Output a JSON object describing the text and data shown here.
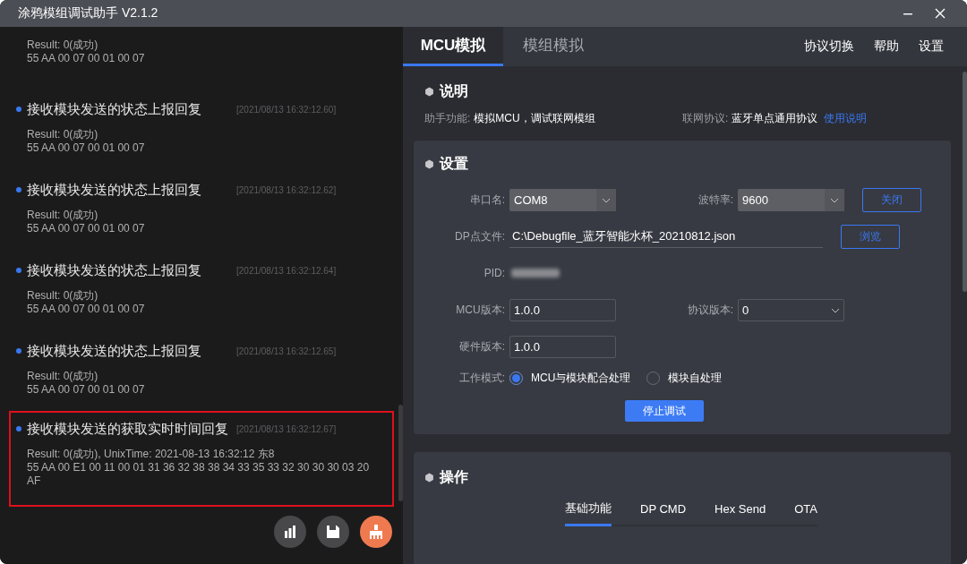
{
  "window": {
    "title": "涂鸦模组调试助手 V2.1.2"
  },
  "log": [
    {
      "result": "Result: 0(成功)",
      "hex": "55 AA 00 07 00 01 00 07",
      "highlighted": false
    },
    {
      "title": "接收模块发送的状态上报回复",
      "time": "[2021/08/13 16:32:12.60]",
      "result": "Result: 0(成功)",
      "hex": "55 AA 00 07 00 01 00 07",
      "highlighted": false
    },
    {
      "title": "接收模块发送的状态上报回复",
      "time": "[2021/08/13 16:32:12.62]",
      "result": "Result: 0(成功)",
      "hex": "55 AA 00 07 00 01 00 07",
      "highlighted": false
    },
    {
      "title": "接收模块发送的状态上报回复",
      "time": "[2021/08/13 16:32:12.64]",
      "result": "Result: 0(成功)",
      "hex": "55 AA 00 07 00 01 00 07",
      "highlighted": false
    },
    {
      "title": "接收模块发送的状态上报回复",
      "time": "[2021/08/13 16:32:12.65]",
      "result": "Result: 0(成功)",
      "hex": "55 AA 00 07 00 01 00 07",
      "highlighted": false
    },
    {
      "title": "接收模块发送的获取实时时间回复",
      "time": "[2021/08/13 16:32:12.67]",
      "result": "Result: 0(成功), UnixTime: 2021-08-13 16:32:12 东8",
      "hex": "55 AA 00 E1 00 11 00 01 31 36 32 38 38 34 33 35 33 32 30 30 30 03 20 AF",
      "highlighted": true
    }
  ],
  "log_actions": [
    {
      "kind": "chart",
      "color": "#48484a"
    },
    {
      "kind": "save",
      "color": "#48484a"
    },
    {
      "kind": "clear",
      "color": "#f07a50"
    }
  ],
  "tabs": [
    {
      "label": "MCU模拟",
      "selected": true
    },
    {
      "label": "模组模拟",
      "selected": false
    }
  ],
  "menu": [
    "协议切换",
    "帮助",
    "设置"
  ],
  "info": {
    "title": "说明",
    "items": [
      {
        "label": "助手功能:",
        "value": "模拟MCU，调试联网模组"
      },
      {
        "label": "联网协议:",
        "value": "蓝牙单点通用协议"
      }
    ],
    "link": "使用说明"
  },
  "settings": {
    "title": "设置",
    "port": {
      "label": "串口名:",
      "value": "COM8"
    },
    "baud": {
      "label": "波特率:",
      "value": "9600"
    },
    "close_button": "关闭",
    "dp_file": {
      "label": "DP点文件:",
      "value": "C:\\Debugfile_蓝牙智能水杯_20210812.json"
    },
    "browse_button": "浏览",
    "pid": {
      "label": "PID:"
    },
    "mcu_version": {
      "label": "MCU版本:",
      "value": "1.0.0"
    },
    "protocol_version": {
      "label": "协议版本:",
      "value": "0"
    },
    "hw_version": {
      "label": "硬件版本:",
      "value": "1.0.0"
    },
    "mode": {
      "label": "工作模式:",
      "options": [
        {
          "label": "MCU与模块配合处理",
          "selected": true
        },
        {
          "label": "模块自处理",
          "selected": false
        }
      ]
    },
    "stop_button": "停止调试"
  },
  "operations": {
    "title": "操作",
    "tabs": [
      {
        "label": "基础功能",
        "selected": true
      },
      {
        "label": "DP CMD",
        "selected": false
      },
      {
        "label": "Hex Send",
        "selected": false
      },
      {
        "label": "OTA",
        "selected": false
      }
    ]
  }
}
